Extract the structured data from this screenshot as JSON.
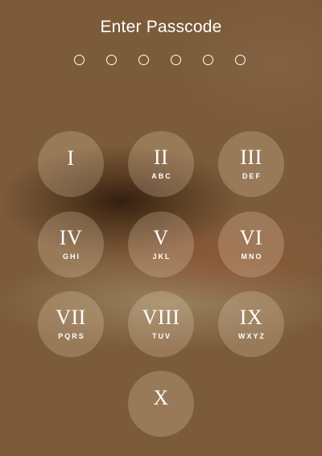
{
  "header": {
    "title": "Enter Passcode"
  },
  "passcode": {
    "length": 6,
    "entered": 0
  },
  "keypad": {
    "keys": [
      {
        "numeral": "I",
        "letters": ""
      },
      {
        "numeral": "II",
        "letters": "ABC"
      },
      {
        "numeral": "III",
        "letters": "DEF"
      },
      {
        "numeral": "IV",
        "letters": "GHI"
      },
      {
        "numeral": "V",
        "letters": "JKL"
      },
      {
        "numeral": "VI",
        "letters": "MNO"
      },
      {
        "numeral": "VII",
        "letters": "PQRS"
      },
      {
        "numeral": "VIII",
        "letters": "TUV"
      },
      {
        "numeral": "IX",
        "letters": "WXYZ"
      },
      {
        "numeral": "X",
        "letters": ""
      }
    ]
  }
}
